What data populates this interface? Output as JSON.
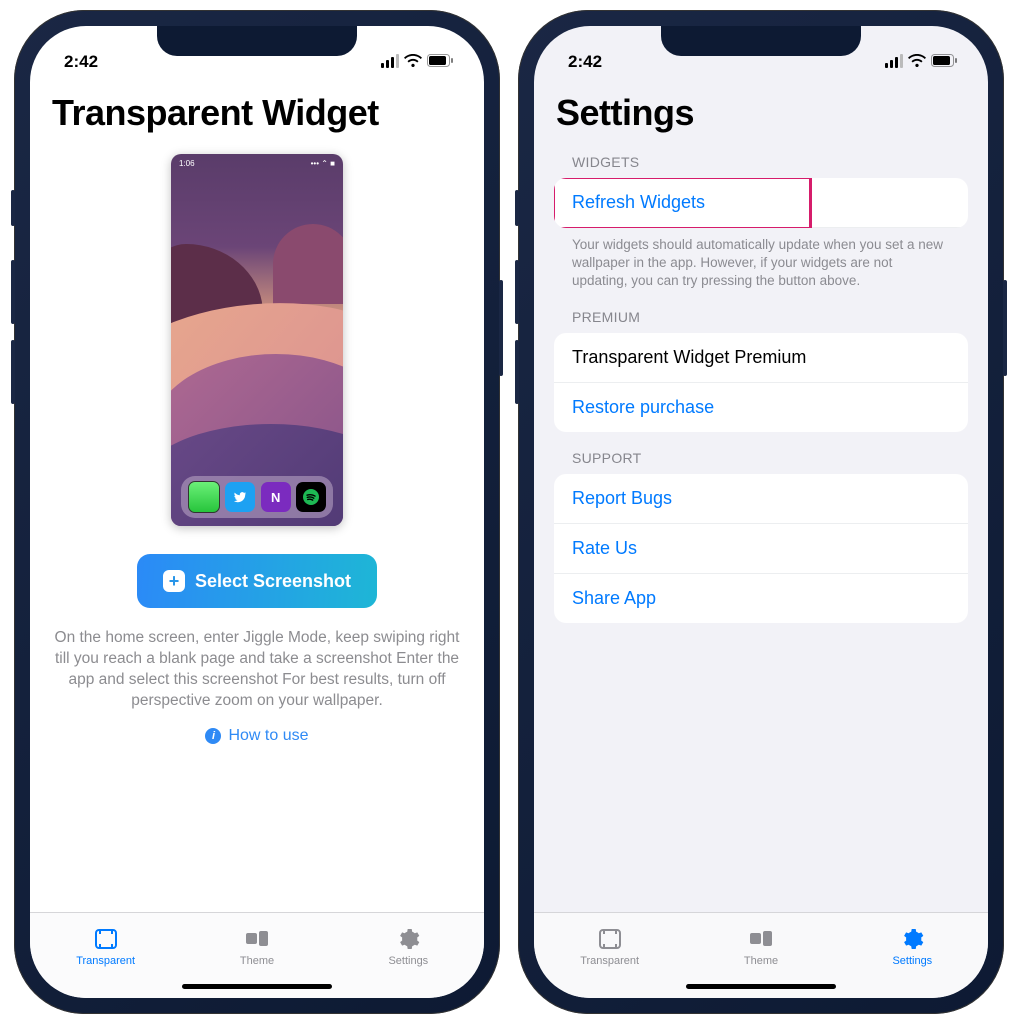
{
  "status": {
    "time": "2:42"
  },
  "left": {
    "title": "Transparent Widget",
    "preview_time": "1:06",
    "select_button": "Select Screenshot",
    "instructions": "On the home screen, enter Jiggle Mode, keep swiping right till you reach a blank page and take a screenshot Enter the app and select this screenshot For best results, turn off perspective zoom on your wallpaper.",
    "how_to_use": "How to use",
    "tabs": {
      "transparent": "Transparent",
      "theme": "Theme",
      "settings": "Settings"
    }
  },
  "right": {
    "title": "Settings",
    "sections": {
      "widgets": {
        "header": "WIDGETS",
        "refresh": "Refresh Widgets",
        "footer": "Your widgets should automatically update when you set a new wallpaper in the app. However, if your widgets are not updating, you can try pressing the button above."
      },
      "premium": {
        "header": "PREMIUM",
        "product": "Transparent Widget Premium",
        "restore": "Restore purchase"
      },
      "support": {
        "header": "SUPPORT",
        "report": "Report Bugs",
        "rate": "Rate Us",
        "share": "Share App"
      }
    },
    "tabs": {
      "transparent": "Transparent",
      "theme": "Theme",
      "settings": "Settings"
    }
  },
  "colors": {
    "accent": "#007aff",
    "highlight": "#d61c6b"
  }
}
